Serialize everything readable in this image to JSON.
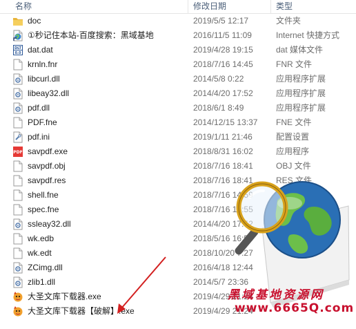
{
  "columns": {
    "name": "名称",
    "date": "修改日期",
    "type": "类型"
  },
  "files": [
    {
      "name": "doc",
      "date": "2019/5/5 12:17",
      "type": "文件夹",
      "icon": "folder-icon"
    },
    {
      "name": "①秒记住本站-百度搜索：黑域基地",
      "date": "2016/11/5 11:09",
      "type": "Internet 快捷方式",
      "icon": "internet-shortcut-icon"
    },
    {
      "name": "dat.dat",
      "date": "2019/4/28 19:15",
      "type": "dat 媒体文件",
      "icon": "dat-file-icon"
    },
    {
      "name": "krnln.fnr",
      "date": "2018/7/16 14:45",
      "type": "FNR 文件",
      "icon": "blank-file-icon"
    },
    {
      "name": "libcurl.dll",
      "date": "2014/5/8 0:22",
      "type": "应用程序扩展",
      "icon": "dll-file-icon"
    },
    {
      "name": "libeay32.dll",
      "date": "2014/4/20 17:52",
      "type": "应用程序扩展",
      "icon": "dll-file-icon"
    },
    {
      "name": "pdf.dll",
      "date": "2018/6/1 8:49",
      "type": "应用程序扩展",
      "icon": "dll-file-icon"
    },
    {
      "name": "PDF.fne",
      "date": "2014/12/15 13:37",
      "type": "FNE 文件",
      "icon": "blank-file-icon"
    },
    {
      "name": "pdf.ini",
      "date": "2019/1/11 21:46",
      "type": "配置设置",
      "icon": "ini-file-icon"
    },
    {
      "name": "savpdf.exe",
      "date": "2018/8/31 16:02",
      "type": "应用程序",
      "icon": "pdf-app-icon"
    },
    {
      "name": "savpdf.obj",
      "date": "2018/7/16 18:41",
      "type": "OBJ 文件",
      "icon": "blank-file-icon"
    },
    {
      "name": "savpdf.res",
      "date": "2018/7/16 18:41",
      "type": "RES 文件",
      "icon": "blank-file-icon"
    },
    {
      "name": "shell.fne",
      "date": "2018/7/16 14:59",
      "type": "FNE 文件",
      "icon": "blank-file-icon"
    },
    {
      "name": "spec.fne",
      "date": "2018/7/16 14:55",
      "type": "",
      "icon": "blank-file-icon"
    },
    {
      "name": "ssleay32.dll",
      "date": "2014/4/20 17:52",
      "type": "",
      "icon": "dll-file-icon"
    },
    {
      "name": "wk.edb",
      "date": "2018/5/16 16:58",
      "type": "",
      "icon": "blank-file-icon"
    },
    {
      "name": "wk.edt",
      "date": "2018/10/20 7:27",
      "type": "",
      "icon": "blank-file-icon"
    },
    {
      "name": "ZCimg.dll",
      "date": "2016/4/18 12:44",
      "type": "",
      "icon": "dll-file-icon"
    },
    {
      "name": "zlib1.dll",
      "date": "2014/5/7 23:36",
      "type": "",
      "icon": "dll-file-icon"
    },
    {
      "name": "大圣文库下载器.exe",
      "date": "2019/4/29 21:24",
      "type": "",
      "icon": "app-exe-icon"
    },
    {
      "name": "大圣文库下载器【破解】.exe",
      "date": "2019/4/29 21:24",
      "type": "",
      "icon": "app-exe-icon"
    }
  ],
  "watermark": {
    "line1": "黑域基地资源网",
    "line2": "www.6665Q.com"
  },
  "colors": {
    "header_text": "#4c607a",
    "meta_text": "#6d6d6d",
    "arrow": "#d32020",
    "watermark": "#c8102e",
    "folder": "#f0c34b",
    "globe": "#2a6fb5"
  }
}
